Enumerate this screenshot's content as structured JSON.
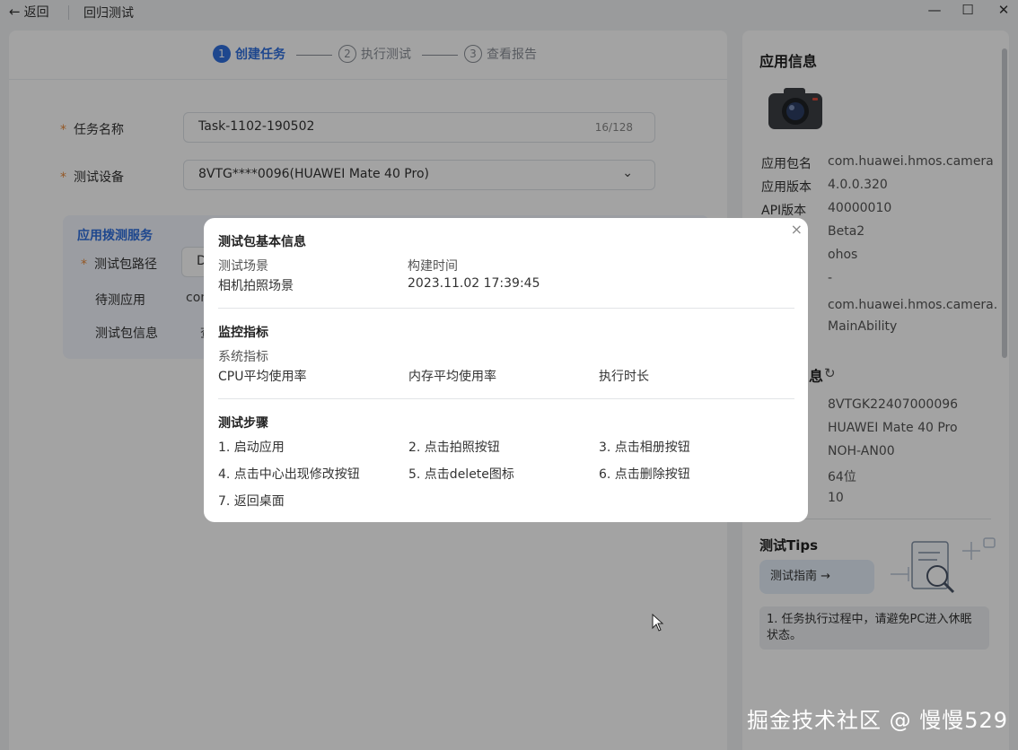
{
  "titlebar": {
    "back_label": "返回",
    "title": "回归测试",
    "minimize_glyph": "—",
    "maximize_glyph": "☐",
    "close_glyph": "✕"
  },
  "steps": [
    {
      "num": "1",
      "label": "创建任务"
    },
    {
      "num": "2",
      "label": "执行测试"
    },
    {
      "num": "3",
      "label": "查看报告"
    }
  ],
  "form": {
    "required_mark": "*",
    "task_name_label": "任务名称",
    "task_name_value": "Task-1102-190502",
    "task_name_counter": "16/128",
    "device_label": "测试设备",
    "device_value": "8VTG****0096(HUAWEI Mate 40 Pro)",
    "chevron": "⌄"
  },
  "service": {
    "title": "应用拨测服务",
    "package_path_label": "测试包路径",
    "package_path_value": "D",
    "app_under_test_label": "待测应用",
    "app_under_test_value": "com",
    "package_info_label": "测试包信息",
    "package_info_value": "查"
  },
  "side": {
    "app_info_title": "应用信息",
    "app_info": [
      {
        "key": "应用包名",
        "value": "com.huawei.hmos.camera"
      },
      {
        "key": "应用版本",
        "value": "4.0.0.320"
      },
      {
        "key": "API版本",
        "value": "40000010"
      },
      {
        "key": "",
        "value": "Beta2"
      },
      {
        "key": "",
        "value": "ohos"
      },
      {
        "key": "",
        "value": "-"
      },
      {
        "key": "",
        "value": "com.huawei.hmos.camera.\nMainAbility"
      }
    ],
    "device_info_title": "息",
    "device_info": [
      {
        "value": "8VTGK22407000096"
      },
      {
        "value": "HUAWEI Mate 40 Pro"
      },
      {
        "value": "NOH-AN00"
      },
      {
        "value": "64位"
      },
      {
        "value": "10"
      }
    ],
    "tips_title": "测试Tips",
    "guide_button": "测试指南 →",
    "tip_text": "1. 任务执行过程中，请避免PC进入休眠状态。"
  },
  "modal": {
    "close_glyph": "×",
    "basic_title": "测试包基本信息",
    "scene_label": "测试场景",
    "scene_value": "相机拍照场景",
    "build_time_label": "构建时间",
    "build_time_value": "2023.11.02 17:39:45",
    "monitor_title": "监控指标",
    "system_metrics_label": "系统指标",
    "metrics": [
      "CPU平均使用率",
      "内存平均使用率",
      "执行时长"
    ],
    "steps_title": "测试步骤",
    "test_steps": [
      "1. 启动应用",
      "2. 点击拍照按钮",
      "3. 点击相册按钮",
      "4. 点击中心出现修改按钮",
      "5. 点击delete图标",
      "6. 点击删除按钮",
      "7. 返回桌面"
    ]
  },
  "watermark": "掘金技术社区 @ 慢慢529",
  "colors": {
    "accent": "#2f6fde",
    "required": "#e8893a"
  }
}
